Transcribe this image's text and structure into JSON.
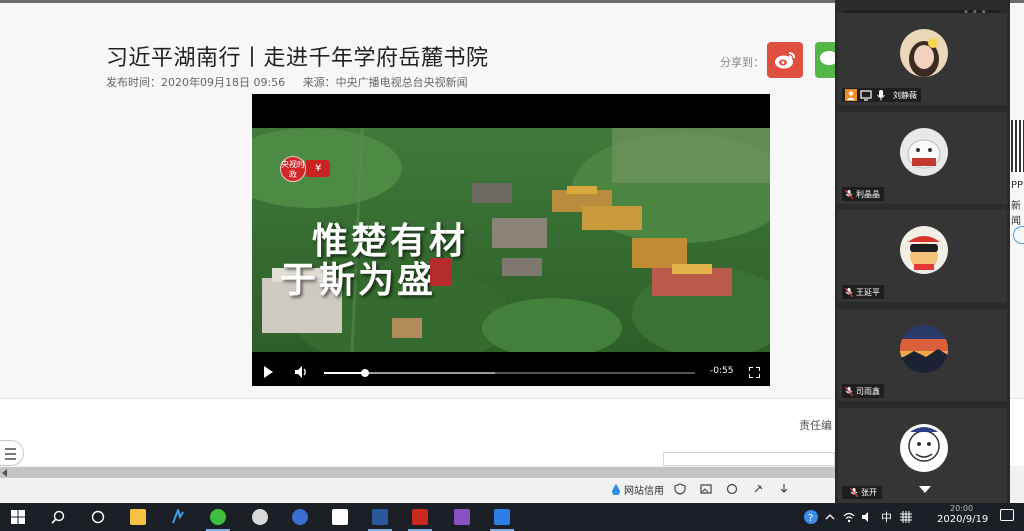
{
  "article": {
    "title": "习近平湖南行丨走进千年学府岳麓书院",
    "publish_time": "发布时间：2020年09月18日 09:56",
    "source": "来源：中央广播电视总台央视新闻",
    "share_label": "分享到：",
    "editor_label": "责任编"
  },
  "video": {
    "logo_text": "央视时政",
    "tag_text": "¥",
    "calligraphy_line1": "惟楚有材",
    "calligraphy_line2": "于斯为盛",
    "time_remaining": "-0:55",
    "progress_fraction": 0.11,
    "buffered_fraction": 0.46
  },
  "side_page": {
    "text_pp": "PP",
    "text_xin": "新闻"
  },
  "participants": [
    {
      "name": "刘静薇",
      "role": "host"
    },
    {
      "name": "利晶晶",
      "role": "member"
    },
    {
      "name": "王延平",
      "role": "member"
    },
    {
      "name": "司雨鑫",
      "role": "member"
    },
    {
      "name": "张开",
      "role": "member"
    }
  ],
  "browser_status": {
    "site_credit": "网站信用"
  },
  "taskbar": {
    "ime_label": "中",
    "clock_date": "2020/9/19",
    "clock_time": "20:00"
  },
  "colors": {
    "weibo": "#e0503f",
    "wechat": "#53b646",
    "panel_bg": "#2b2b2b",
    "taskbar_bg": "#1b1f26"
  }
}
